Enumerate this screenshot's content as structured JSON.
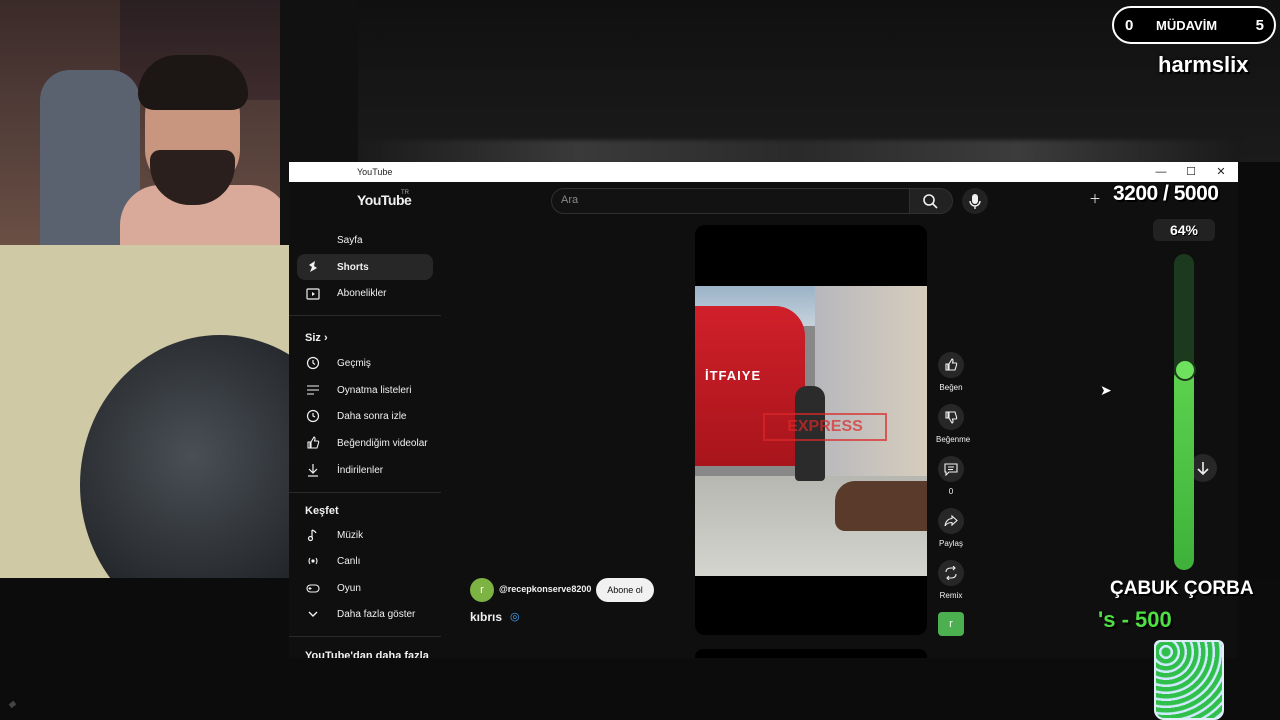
{
  "window": {
    "title": "YouTube",
    "controls": [
      "—",
      "☐",
      "✕"
    ]
  },
  "header": {
    "logo": "YouTube",
    "region": "TR",
    "search_placeholder": "Ara",
    "create_label": "Oluştur"
  },
  "sidebar": {
    "home_label": "Sayfa",
    "items_main": [
      {
        "label": "Shorts",
        "icon": "shorts-icon",
        "active": true
      },
      {
        "label": "Abonelikler",
        "icon": "subscriptions-icon"
      }
    ],
    "you_section": "Siz",
    "items_you": [
      {
        "label": "Geçmiş",
        "icon": "history-icon"
      },
      {
        "label": "Oynatma listeleri",
        "icon": "playlist-icon"
      },
      {
        "label": "Daha sonra izle",
        "icon": "clock-icon"
      },
      {
        "label": "Beğendiğim videolar",
        "icon": "thumbs-up-icon"
      },
      {
        "label": "İndirilenler",
        "icon": "download-icon"
      }
    ],
    "explore_section": "Keşfet",
    "items_explore": [
      {
        "label": "Müzik",
        "icon": "music-icon"
      },
      {
        "label": "Canlı",
        "icon": "live-icon"
      },
      {
        "label": "Oyun",
        "icon": "gaming-icon"
      },
      {
        "label": "Daha fazla göster",
        "icon": "chevron-down-icon"
      }
    ],
    "more_from_youtube": "YouTube'dan daha fazla"
  },
  "short": {
    "channel_initial": "r",
    "channel_handle": "@recepkonserve8200",
    "subscribe_label": "Abone ol",
    "title": "kıbrıs",
    "video_overlay_text": "İTFAIYE",
    "video_watermark": "EXPRESS"
  },
  "actions": {
    "like": "Beğen",
    "dislike": "Beğenme",
    "comments": "0",
    "share": "Paylaş",
    "remix": "Remix"
  },
  "overlay": {
    "pill_left": "0",
    "pill_label": "MÜDAVİM",
    "pill_right": "5",
    "streamer": "harmslix",
    "goal_text": "3200 / 5000",
    "goal_percent": "64%",
    "goal_progress": 0.64,
    "reward_name": "ÇABUK ÇORBA",
    "reward_price": "'s - 500"
  },
  "colors": {
    "accent_green": "#4ee043",
    "youtube_bg": "#0f0f0f"
  }
}
